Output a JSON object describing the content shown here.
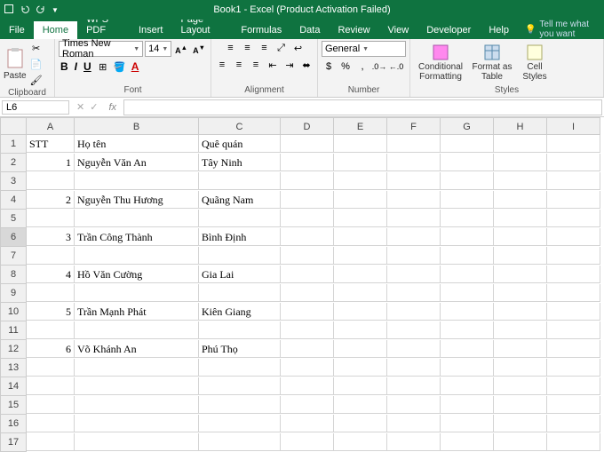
{
  "title": "Book1 - Excel (Product Activation Failed)",
  "tabs": {
    "file": "File",
    "home": "Home",
    "wps": "WPS PDF",
    "insert": "Insert",
    "pagelayout": "Page Layout",
    "formulas": "Formulas",
    "data": "Data",
    "review": "Review",
    "view": "View",
    "developer": "Developer",
    "help": "Help",
    "tellme": "Tell me what you want"
  },
  "ribbon": {
    "clipboard": {
      "paste": "Paste",
      "label": "Clipboard"
    },
    "font": {
      "name": "Times New Roman",
      "size": "14",
      "label": "Font",
      "bold": "B",
      "italic": "I",
      "underline": "U",
      "incA": "A",
      "decA": "A"
    },
    "alignment": {
      "label": "Alignment"
    },
    "number": {
      "format": "General",
      "label": "Number"
    },
    "styles": {
      "cond": "Conditional Formatting",
      "table": "Format as Table",
      "cell": "Cell Styles",
      "label": "Styles"
    }
  },
  "namebox": "L6",
  "columns": [
    "A",
    "B",
    "C",
    "D",
    "E",
    "F",
    "G",
    "H",
    "I"
  ],
  "rows": [
    {
      "n": "1",
      "a": "STT",
      "b": "Họ tên",
      "c": "Quê quán"
    },
    {
      "n": "2",
      "a": "1",
      "b": "Nguyễn Văn An",
      "c": "Tây Ninh"
    },
    {
      "n": "3"
    },
    {
      "n": "4",
      "a": "2",
      "b": "Nguyễn Thu Hương",
      "c": "Quãng Nam"
    },
    {
      "n": "5"
    },
    {
      "n": "6",
      "a": "3",
      "b": "Trần Công Thành",
      "c": "Bình Định"
    },
    {
      "n": "7"
    },
    {
      "n": "8",
      "a": "4",
      "b": "Hồ Văn Cường",
      "c": "Gia Lai"
    },
    {
      "n": "9"
    },
    {
      "n": "10",
      "a": "5",
      "b": "Trần Mạnh Phát",
      "c": "Kiên Giang"
    },
    {
      "n": "11"
    },
    {
      "n": "12",
      "a": "6",
      "b": "Võ Khánh An",
      "c": "Phú Thọ"
    },
    {
      "n": "13"
    },
    {
      "n": "14"
    },
    {
      "n": "15"
    },
    {
      "n": "16"
    },
    {
      "n": "17"
    }
  ],
  "colwidths": {
    "A": "w-a",
    "B": "w-b",
    "C": "w-c",
    "D": "w-d",
    "E": "w-e",
    "F": "w-f",
    "G": "w-g",
    "H": "w-h",
    "I": "w-i"
  },
  "selectedRow": "6"
}
